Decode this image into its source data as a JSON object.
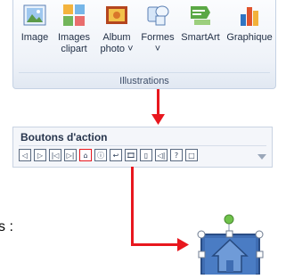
{
  "ribbon": {
    "buttons": [
      {
        "label": "Image",
        "icon": "image-icon"
      },
      {
        "label": "Images clipart",
        "icon": "clipart-icon"
      },
      {
        "label": "Album photo ˅",
        "icon": "photo-album-icon"
      },
      {
        "label": "Formes ˅",
        "icon": "shapes-icon"
      },
      {
        "label": "SmartArt",
        "icon": "smartart-icon"
      },
      {
        "label": "Graphique",
        "icon": "chart-icon"
      }
    ],
    "group_title": "Illustrations"
  },
  "action_panel": {
    "title": "Boutons d'action",
    "buttons": [
      "◁",
      "▷",
      "|◁",
      "▷|",
      "⌂",
      "ⓘ",
      "↩",
      "🎞",
      "▯",
      "◁|",
      "?",
      "□"
    ]
  },
  "caption": "s :",
  "colors": {
    "arrow": "#e8171e",
    "shape_fill": "#3f6db3",
    "shape_border": "#2a4d86",
    "handle": "#6fc24a"
  }
}
